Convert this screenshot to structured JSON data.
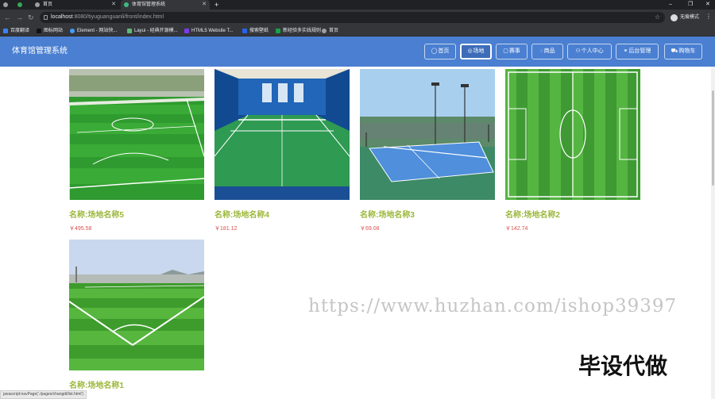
{
  "browser": {
    "tabs": [
      {
        "label": ""
      },
      {
        "label": ""
      },
      {
        "label": "首页"
      },
      {
        "label": "体育馆管理系统"
      }
    ],
    "new_tab": "+",
    "window_controls": [
      "–",
      "❐",
      "✕"
    ],
    "url_host": "localhost",
    "url_rest": ":8080/tiyuguanguanli/front/index.html",
    "profile_label": "无痕模式",
    "bookmarks": [
      {
        "label": "百度翻译",
        "color": "#3b82f6"
      },
      {
        "label": "图标网站",
        "color": "#111111"
      },
      {
        "label": "Element - 网站快...",
        "color": "#409eff"
      },
      {
        "label": "Layui - 经典开源模...",
        "color": "#5fb878"
      },
      {
        "label": "HTML5 Website T...",
        "color": "#7c3aed"
      },
      {
        "label": "搜索壁纸",
        "color": "#2563eb"
      },
      {
        "label": "新经验多实线规则",
        "color": "#16a34a"
      },
      {
        "label": "首页",
        "color": "#9aa0a6"
      }
    ]
  },
  "header": {
    "title": "体育馆管理系统",
    "nav": [
      {
        "label": "首页",
        "icon": "home-icon",
        "glyph": "◯"
      },
      {
        "label": "场地",
        "icon": "venue-icon",
        "glyph": "◎"
      },
      {
        "label": "赛事",
        "icon": "calendar-icon",
        "glyph": "▢"
      },
      {
        "label": "商品",
        "icon": "goods-icon",
        "glyph": "◌"
      },
      {
        "label": "个人中心",
        "icon": "user-icon",
        "glyph": "⚇"
      },
      {
        "label": "后台管理",
        "icon": "link-icon",
        "glyph": "⚭"
      },
      {
        "label": "购物车",
        "icon": "cart-icon",
        "glyph": "⛟"
      }
    ],
    "active_index": 1
  },
  "venues": [
    {
      "name": "名称:场地名称5",
      "price": "￥495.58",
      "image": "soccer-field-perspective"
    },
    {
      "name": "名称:场地名称4",
      "price": "￥181.12",
      "image": "indoor-badminton-court"
    },
    {
      "name": "名称:场地名称3",
      "price": "￥69.08",
      "image": "outdoor-tennis-court"
    },
    {
      "name": "名称:场地名称2",
      "price": "￥142.74",
      "image": "soccer-field-aerial"
    },
    {
      "name": "名称:场地名称1",
      "price": "",
      "image": "soccer-field-corner"
    }
  ],
  "overlay": {
    "watermark": "https://www.huzhan.com/ishop39397",
    "stamp": "毕设代做"
  },
  "status_bar": "javascript:navPage('./pages/changdi/list.html')",
  "colors": {
    "header_bg": "#4a7fd1",
    "venue_name": "#9bb73a",
    "price": "#d9534f"
  }
}
